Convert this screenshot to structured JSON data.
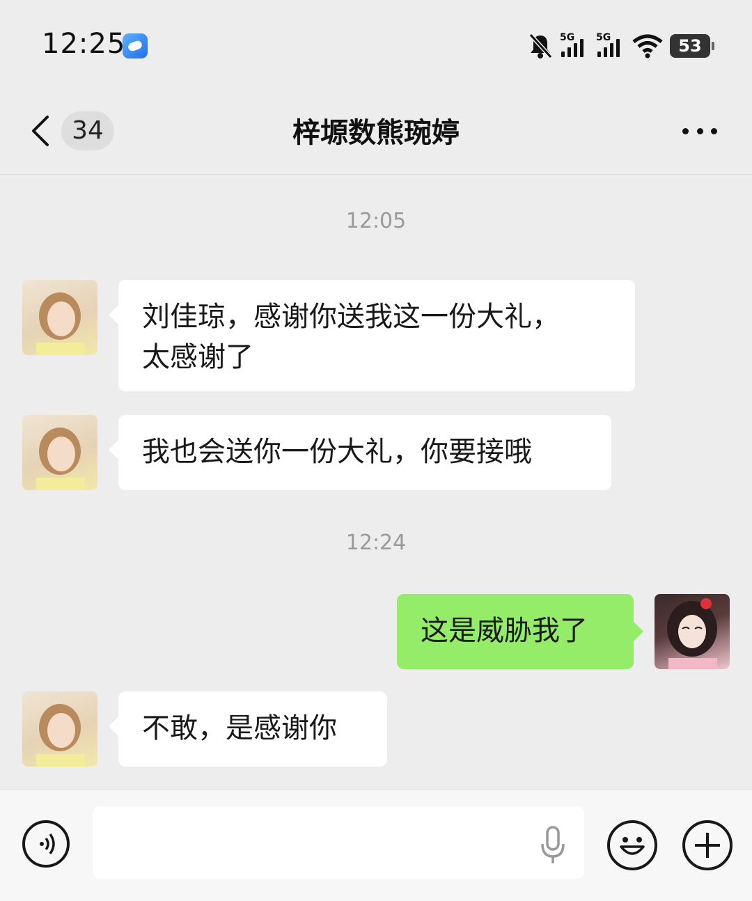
{
  "status_bar": {
    "time": "12:25",
    "signal1_label": "5G",
    "signal2_label": "5G",
    "battery": "53",
    "icons": [
      "app-notification-icon",
      "mute-bell-icon",
      "signal-5g-icon",
      "signal-5g-icon",
      "wifi-icon",
      "battery-icon"
    ]
  },
  "header": {
    "back_icon": "chevron-left-icon",
    "unread_count": "34",
    "title": "梓塬数熊琬婷",
    "more_icon": "more-dots-icon"
  },
  "messages": [
    {
      "type": "time",
      "text": "12:05"
    },
    {
      "type": "incoming",
      "avatar": "avatar-contact",
      "lines": [
        "刘佳琼，感谢你送我这一份大礼，",
        "太感谢了"
      ]
    },
    {
      "type": "incoming",
      "avatar": "avatar-contact",
      "lines": [
        "我也会送你一份大礼，你要接哦"
      ]
    },
    {
      "type": "time",
      "text": "12:24"
    },
    {
      "type": "outgoing",
      "avatar": "avatar-self",
      "lines": [
        "这是威胁我了"
      ]
    },
    {
      "type": "incoming",
      "avatar": "avatar-contact",
      "lines": [
        "不敢，是感谢你"
      ]
    }
  ],
  "input_bar": {
    "voice_icon": "voice-mode-icon",
    "text_value": "",
    "mic_icon": "microphone-icon",
    "emoji_icon": "emoji-smile-icon",
    "plus_icon": "plus-icon"
  },
  "colors": {
    "background": "#ededed",
    "bubble_incoming": "#ffffff",
    "bubble_outgoing": "#95ec69",
    "timestamp": "#9a9a9a"
  }
}
